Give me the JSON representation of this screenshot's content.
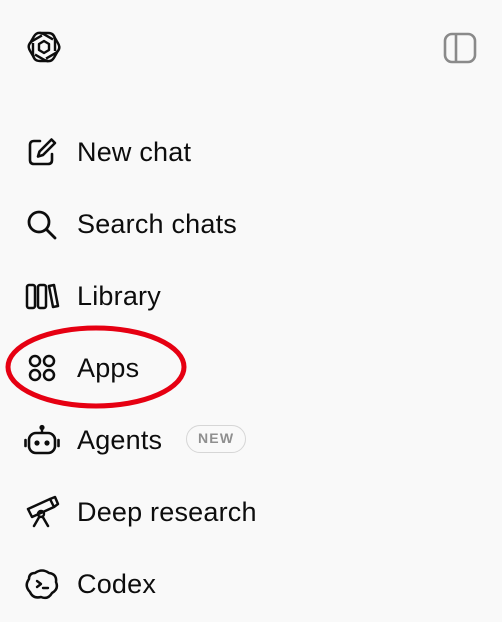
{
  "header": {
    "logo_icon": "openai-logo-icon",
    "sidebar_toggle_icon": "sidebar-toggle-icon"
  },
  "nav": {
    "items": [
      {
        "label": "New chat",
        "icon": "pencil-square-icon"
      },
      {
        "label": "Search chats",
        "icon": "search-icon"
      },
      {
        "label": "Library",
        "icon": "library-books-icon"
      },
      {
        "label": "Apps",
        "icon": "apps-grid-icon"
      },
      {
        "label": "Agents",
        "icon": "robot-icon",
        "badge": "NEW"
      },
      {
        "label": "Deep research",
        "icon": "telescope-icon"
      },
      {
        "label": "Codex",
        "icon": "codex-cloud-icon"
      }
    ]
  },
  "annotation": {
    "shape": "ellipse",
    "color": "#e60012",
    "target": "Apps"
  },
  "colors": {
    "background": "#f9f9f9",
    "text": "#0d0d0d",
    "badge_border": "#d6d6d6",
    "badge_text": "#8f8f8f"
  }
}
